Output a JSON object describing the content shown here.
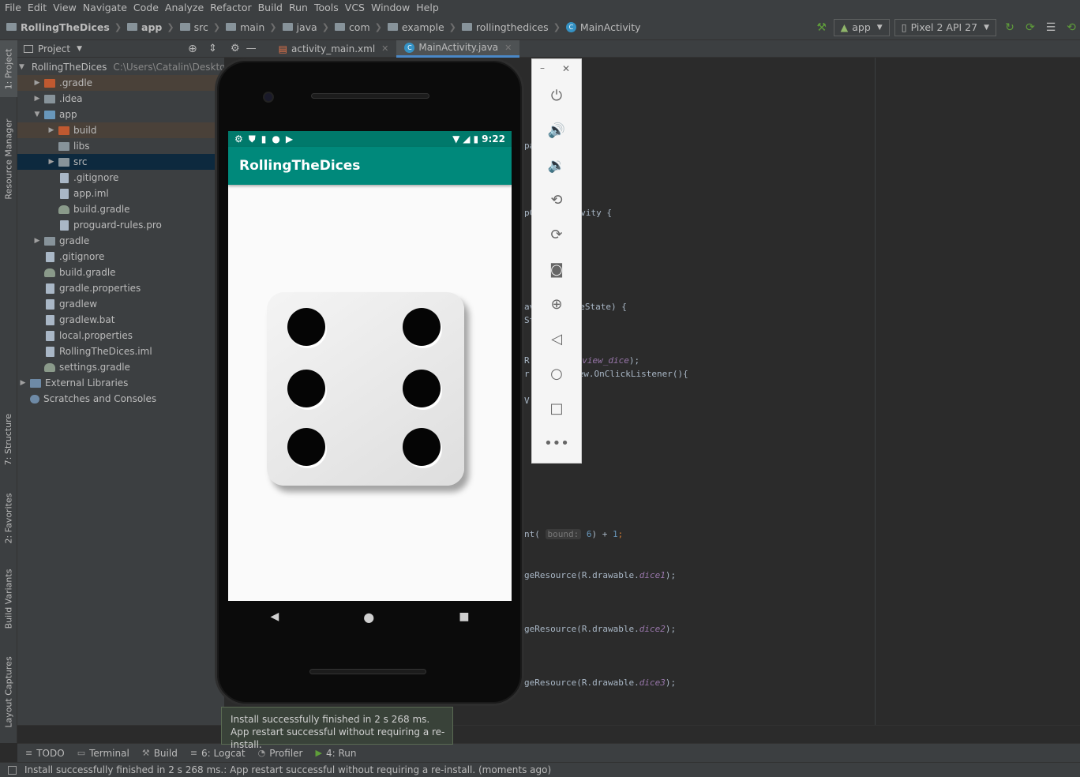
{
  "menu": [
    "File",
    "Edit",
    "View",
    "Navigate",
    "Code",
    "Analyze",
    "Refactor",
    "Build",
    "Run",
    "Tools",
    "VCS",
    "Window",
    "Help"
  ],
  "breadcrumb": [
    "RollingTheDices",
    "app",
    "src",
    "main",
    "java",
    "com",
    "example",
    "rollingthedices",
    "MainActivity"
  ],
  "toolbar": {
    "run_config": "app",
    "device": "Pixel 2 API 27"
  },
  "left_tabs": [
    "1: Project",
    "Resource Manager",
    "7: Structure",
    "2: Favorites",
    "Build Variants",
    "Layout Captures"
  ],
  "project_panel": {
    "title": "Project",
    "root_label": "RollingTheDices",
    "root_path": "C:\\Users\\Catalin\\Desktop",
    "items": [
      ".gradle",
      ".idea",
      "app",
      "build",
      "libs",
      "src",
      ".gitignore",
      "app.iml",
      "build.gradle",
      "proguard-rules.pro",
      "gradle",
      ".gitignore",
      "build.gradle",
      "gradle.properties",
      "gradlew",
      "gradlew.bat",
      "local.properties",
      "RollingTheDices.iml",
      "settings.gradle",
      "External Libraries",
      "Scratches and Consoles"
    ]
  },
  "editor_tabs": [
    {
      "label": "activity_main.xml"
    },
    {
      "label": "MainActivity.java"
    }
  ],
  "code_fragments": {
    "l1": "pa",
    "l2": ";",
    "l3": "pC",
    "l4": "vity {",
    "l5": "av",
    "l6": "eState) {",
    "l7": "St",
    "l8": "R",
    "l9": "_view_dice",
    "l10": ");",
    "l11": "r",
    "l12": "ew.OnClickListener(){",
    "l13": "V",
    "l14": "nt(",
    "l15": "bound:",
    "l16": "6",
    "l17": ") + ",
    "l18": "1",
    "l19": ";",
    "l20": "geResource(R.drawable.",
    "l21": "dice1",
    "l22": "dice2",
    "l23": "dice3"
  },
  "emulator": {
    "time": "9:22",
    "app_title": "RollingTheDices",
    "dice_value": 6
  },
  "bottom_tools": [
    {
      "icon": "≡",
      "label": "TODO"
    },
    {
      "icon": "▭",
      "label": "Terminal"
    },
    {
      "icon": "⚒",
      "label": "Build"
    },
    {
      "icon": "≡",
      "label": "6: Logcat"
    },
    {
      "icon": "◔",
      "label": "Profiler"
    },
    {
      "icon": "▶",
      "label": "4: Run"
    }
  ],
  "balloon": {
    "line1": "Install successfully finished in 2 s 268 ms.",
    "line2": "App restart successful without requiring a re-install."
  },
  "status_text": "Install successfully finished in 2 s 268 ms.: App restart successful without requiring a re-install. (moments ago)"
}
